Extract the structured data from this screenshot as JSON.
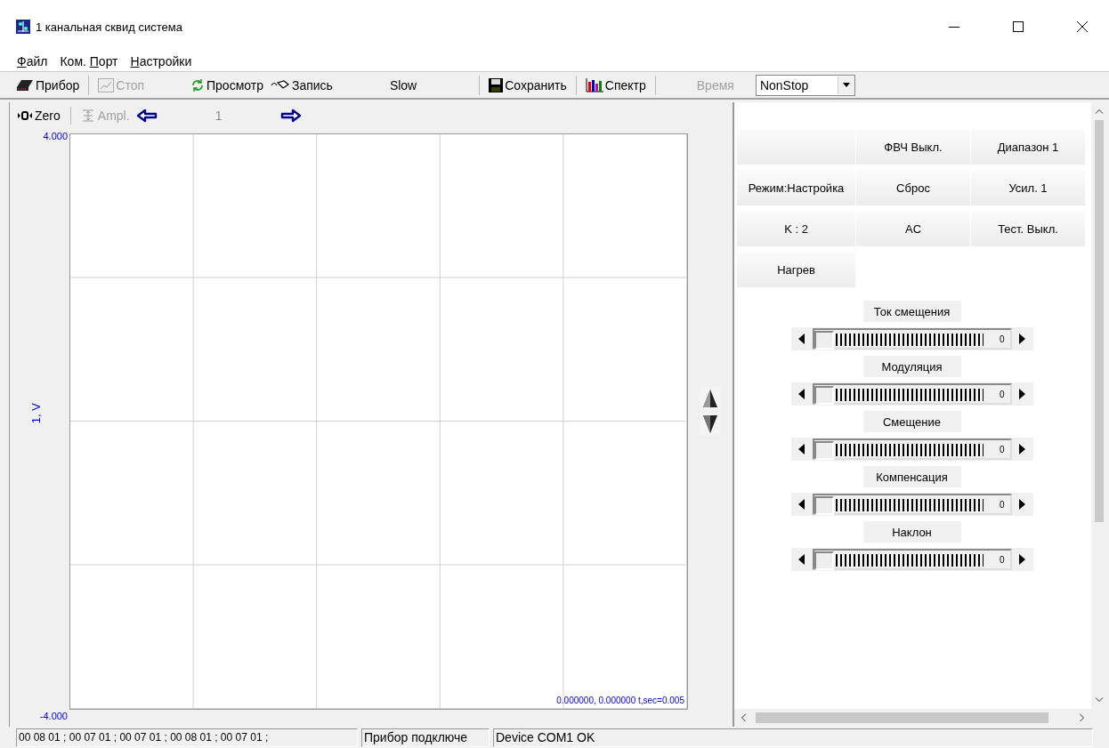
{
  "window": {
    "title": "1 канальная сквид система"
  },
  "menu": [
    {
      "key": "Ф",
      "rest": "айл"
    },
    {
      "prefix": "Ком. ",
      "key": "П",
      "rest": "орт"
    },
    {
      "key": "Н",
      "rest": "астройки"
    }
  ],
  "toolbar": {
    "device": {
      "label": "Прибор",
      "disabled": false
    },
    "stop": {
      "label": "Стоп",
      "disabled": true
    },
    "view": {
      "label": "Просмотр",
      "disabled": false
    },
    "record": {
      "label": "Запись",
      "disabled": false
    },
    "speed": {
      "label": "Slow",
      "disabled": false
    },
    "save": {
      "label": "Сохранить",
      "disabled": false
    },
    "spectrum": {
      "label": "Спектр",
      "disabled": false
    },
    "time": {
      "label": "Время",
      "disabled": true
    },
    "mode": {
      "value": "NonStop"
    }
  },
  "plot_toolbar": {
    "zero": {
      "label": "Zero",
      "disabled": false
    },
    "ampl": {
      "label": "Ampl.",
      "disabled": true
    },
    "page": "1"
  },
  "plot": {
    "y_max": "4.000",
    "y_min": "-4.000",
    "y_label": "1, V",
    "readout": "0.000000, 0.000000 t,sec=0.005"
  },
  "controls": [
    [
      {
        "kind": "blank"
      },
      {
        "kind": "button",
        "label": "ФВЧ Выкл."
      },
      {
        "kind": "button",
        "label": "Диапазон 1"
      }
    ],
    [
      {
        "kind": "button",
        "label": "Режим:Настройка"
      },
      {
        "kind": "button",
        "label": "Сброс"
      },
      {
        "kind": "button",
        "label": "Усил. 1"
      }
    ],
    [
      {
        "kind": "button",
        "label": "K : 2"
      },
      {
        "kind": "button",
        "label": "AC"
      },
      {
        "kind": "button",
        "label": "Тест. Выкл."
      }
    ],
    [
      {
        "kind": "button",
        "label": "Нагрев"
      }
    ]
  ],
  "sliders": [
    {
      "label": "Ток смещения",
      "level": 0,
      "reading": "0"
    },
    {
      "label": "Модуляция",
      "level": 0,
      "reading": "0"
    },
    {
      "label": "Смещение",
      "level": 0,
      "reading": "0"
    },
    {
      "label": "Компенсация",
      "level": 0,
      "reading": "0"
    },
    {
      "label": "Наклон",
      "level": 0,
      "reading": "0"
    }
  ],
  "status_bar": [
    "00 08 01 ; 00 07 01 ; 00 07 01 ; 00 08 01 ; 00 07 01 ;",
    "Прибор подключе",
    "Device COM1 OK"
  ]
}
